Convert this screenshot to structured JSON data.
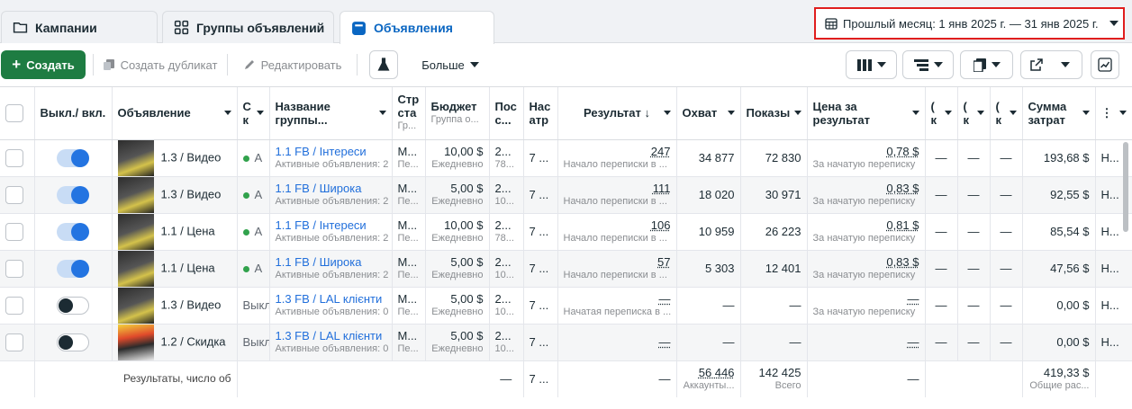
{
  "tabs": [
    {
      "label": "Кампании",
      "icon": "folder-icon"
    },
    {
      "label": "Группы объявлений",
      "icon": "grid-icon"
    },
    {
      "label": "Объявления",
      "icon": "ad-card-icon"
    }
  ],
  "date_range": {
    "label": "Прошлый месяц: 1 янв 2025 г. — 31 янв 2025 г."
  },
  "toolbar": {
    "create": "Создать",
    "duplicate": "Создать дубликат",
    "edit": "Редактировать",
    "more": "Больше"
  },
  "columns": [
    {
      "label": "Выкл./ вкл."
    },
    {
      "label": "Объявление"
    },
    {
      "label": "С к"
    },
    {
      "label": "Название группы..."
    },
    {
      "label": "Стр ста",
      "sub": "Гр..."
    },
    {
      "label": "Бюджет",
      "sub": "Группа о..."
    },
    {
      "label": "Пос с..."
    },
    {
      "label": "Нас атр"
    },
    {
      "label": "Результат ↓"
    },
    {
      "label": "Охват"
    },
    {
      "label": "Показы"
    },
    {
      "label": "Цена за результат"
    },
    {
      "label": "( к"
    },
    {
      "label": "( к"
    },
    {
      "label": "( к"
    },
    {
      "label": "Сумма затрат"
    },
    {
      "label": "⋮"
    }
  ],
  "rows": [
    {
      "on": true,
      "ad": "1.3 / Видео",
      "status": "А",
      "group": "1.1 FB / Інтереси",
      "group_sub": "Активные объявления: 2",
      "str": "М...",
      "str_sub": "Пе...",
      "budget": "10,00 $",
      "budget_sub": "Ежедневно",
      "pos": "2...",
      "pos_sub": "78...",
      "nas": "7 ...",
      "result": "247",
      "result_sub": "Начало переписки в ...",
      "reach": "34 877",
      "impr": "72 830",
      "cpr": "0,78 $",
      "cpr_sub": "За начатую переписку",
      "c1": "—",
      "c2": "—",
      "c3": "—",
      "spend": "193,68 $",
      "last": "Н..."
    },
    {
      "on": true,
      "ad": "1.3 / Видео",
      "status": "А",
      "group": "1.1 FB / Широка",
      "group_sub": "Активные объявления: 2",
      "str": "М...",
      "str_sub": "Пе...",
      "budget": "5,00 $",
      "budget_sub": "Ежедневно",
      "pos": "2...",
      "pos_sub": "10...",
      "nas": "7 ...",
      "result": "111",
      "result_sub": "Начало переписки в ...",
      "reach": "18 020",
      "impr": "30 971",
      "cpr": "0,83 $",
      "cpr_sub": "За начатую переписку",
      "c1": "—",
      "c2": "—",
      "c3": "—",
      "spend": "92,55 $",
      "last": "Н..."
    },
    {
      "on": true,
      "ad": "1.1 / Цена",
      "status": "А",
      "group": "1.1 FB / Інтереси",
      "group_sub": "Активные объявления: 2",
      "str": "М...",
      "str_sub": "Пе...",
      "budget": "10,00 $",
      "budget_sub": "Ежедневно",
      "pos": "2...",
      "pos_sub": "78...",
      "nas": "7 ...",
      "result": "106",
      "result_sub": "Начало переписки в ...",
      "reach": "10 959",
      "impr": "26 223",
      "cpr": "0,81 $",
      "cpr_sub": "За начатую переписку",
      "c1": "—",
      "c2": "—",
      "c3": "—",
      "spend": "85,54 $",
      "last": "Н..."
    },
    {
      "on": true,
      "ad": "1.1 / Цена",
      "status": "А",
      "group": "1.1 FB / Широка",
      "group_sub": "Активные объявления: 2",
      "str": "М...",
      "str_sub": "Пе...",
      "budget": "5,00 $",
      "budget_sub": "Ежедневно",
      "pos": "2...",
      "pos_sub": "10...",
      "nas": "7 ...",
      "result": "57",
      "result_sub": "Начало переписки в ...",
      "reach": "5 303",
      "impr": "12 401",
      "cpr": "0,83 $",
      "cpr_sub": "За начатую переписку",
      "c1": "—",
      "c2": "—",
      "c3": "—",
      "spend": "47,56 $",
      "last": "Н..."
    },
    {
      "on": false,
      "ad": "1.3 / Видео",
      "status": "Выкл",
      "group": "1.3 FB / LAL клієнти",
      "group_sub": "Активные объявления: 0",
      "str": "М...",
      "str_sub": "Пе...",
      "budget": "5,00 $",
      "budget_sub": "Ежедневно",
      "pos": "2...",
      "pos_sub": "10...",
      "nas": "7 ...",
      "result": "—",
      "result_sub": "Начатая переписка в ...",
      "reach": "—",
      "impr": "—",
      "cpr": "—",
      "cpr_sub": "За начатую переписку",
      "c1": "—",
      "c2": "—",
      "c3": "—",
      "spend": "0,00 $",
      "last": "Н..."
    },
    {
      "on": false,
      "ad": "1.2 / Скидка",
      "status": "Выкл",
      "group": "1.3 FB / LAL клієнти",
      "group_sub": "Активные объявления: 0",
      "str": "М...",
      "str_sub": "Пе...",
      "budget": "5,00 $",
      "budget_sub": "Ежедневно",
      "pos": "2...",
      "pos_sub": "10...",
      "nas": "7 ...",
      "result": "—",
      "result_sub": "",
      "reach": "—",
      "impr": "—",
      "cpr": "—",
      "cpr_sub": "",
      "c1": "—",
      "c2": "—",
      "c3": "—",
      "spend": "0,00 $",
      "last": "Н..."
    }
  ],
  "footer": {
    "label": "Результаты, число об",
    "pos": "—",
    "nas": "7 ...",
    "result": "—",
    "reach": "56 446",
    "reach_sub": "Аккаунты...",
    "impr": "142 425",
    "impr_sub": "Всего",
    "cpr": "—",
    "spend": "419,33 $",
    "spend_sub": "Общие рас..."
  }
}
